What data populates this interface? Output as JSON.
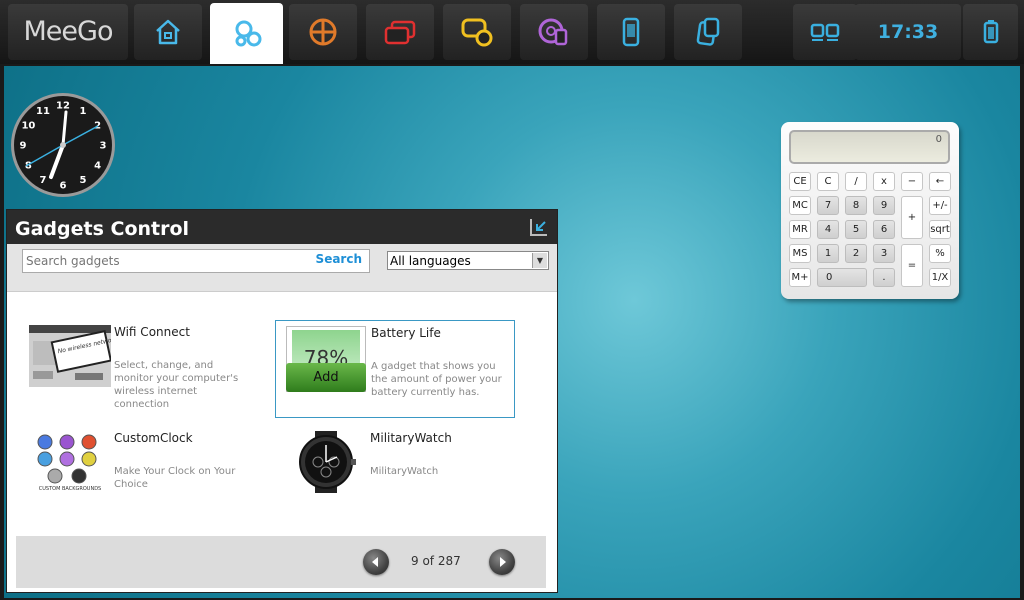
{
  "topbar": {
    "logo": "MeeGo",
    "zones": [
      {
        "icon": "home-icon",
        "color": "#49b9ea"
      },
      {
        "icon": "people-icon",
        "color": "#49b9ea",
        "active": true
      },
      {
        "icon": "web-icon",
        "color": "#e07a2a"
      },
      {
        "icon": "windows-icon",
        "color": "#e03030"
      },
      {
        "icon": "messages-icon",
        "color": "#f0c020"
      },
      {
        "icon": "media-icon",
        "color": "#b065d8"
      },
      {
        "icon": "devices-icon",
        "color": "#3ab0e0"
      },
      {
        "icon": "apps-icon",
        "color": "#3ab0e0"
      }
    ],
    "status_icon": "zones-icon",
    "time": "17:33",
    "battery_icon": "battery-icon"
  },
  "gadgets_panel": {
    "title": "Gadgets Control",
    "search_placeholder": "Search gadgets",
    "search_label": "Search",
    "language": "All languages",
    "items": [
      {
        "name": "Wifi Connect",
        "description": "Select, change, and monitor your computer's wireless internet connection"
      },
      {
        "name": "Battery Life",
        "description": "A gadget that shows you the amount of power your battery currently has.",
        "preview_value": "78%",
        "add_label": "Add"
      },
      {
        "name": "CustomClock",
        "description": "Make Your Clock on Your Choice",
        "thumb_caption": "CUSTOM BACKGROUNDS"
      },
      {
        "name": "MilitaryWatch",
        "description": "MilitaryWatch"
      }
    ],
    "page_counter": "9 of 287",
    "wifi_thumb_text": "No wireless networks available"
  },
  "clock_gadget": {
    "hours": [
      "12",
      "1",
      "2",
      "3",
      "4",
      "5",
      "6",
      "7",
      "8",
      "9",
      "10",
      "11"
    ]
  },
  "calculator": {
    "display": "0",
    "rows": [
      [
        "CE",
        "C",
        "/",
        "x",
        "−",
        "←"
      ],
      [
        "MC",
        "7",
        "8",
        "9",
        "+",
        "+/-"
      ],
      [
        "MR",
        "4",
        "5",
        "6",
        "sqrt"
      ],
      [
        "MS",
        "1",
        "2",
        "3",
        "=",
        "%"
      ],
      [
        "M+",
        "0",
        ".",
        "1/X"
      ]
    ]
  }
}
